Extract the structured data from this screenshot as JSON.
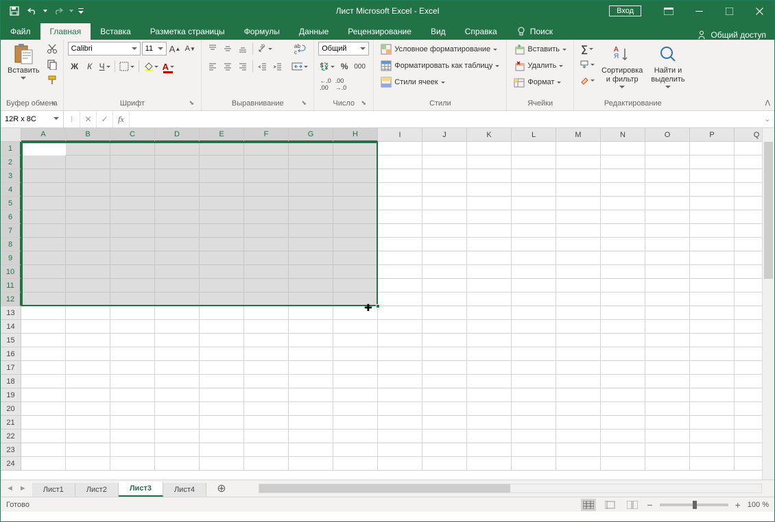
{
  "title": "Лист Microsoft Excel  -  Excel",
  "qat": {
    "save": "💾",
    "undo": "↶",
    "redo": "↷"
  },
  "login_label": "Вход",
  "tabs": {
    "file": "Файл",
    "items": [
      "Главная",
      "Вставка",
      "Разметка страницы",
      "Формулы",
      "Данные",
      "Рецензирование",
      "Вид",
      "Справка"
    ],
    "active": "Главная",
    "tell_me": "Поиск",
    "share": "Общий доступ"
  },
  "ribbon": {
    "clipboard": {
      "label": "Буфер обмена",
      "paste": "Вставить"
    },
    "font": {
      "label": "Шрифт",
      "name": "Calibri",
      "size": "11",
      "bold": "Ж",
      "italic": "К",
      "underline": "Ч"
    },
    "alignment": {
      "label": "Выравнивание"
    },
    "number": {
      "label": "Число",
      "format": "Общий"
    },
    "styles": {
      "label": "Стили",
      "cond_fmt": "Условное форматирование",
      "as_table": "Форматировать как таблицу",
      "cell_styles": "Стили ячеек"
    },
    "cells": {
      "label": "Ячейки",
      "insert": "Вставить",
      "delete": "Удалить",
      "format": "Формат"
    },
    "editing": {
      "label": "Редактирование",
      "sort": "Сортировка\nи фильтр",
      "find": "Найти и\nвыделить"
    }
  },
  "name_box": "12R x 8C",
  "columns": [
    "A",
    "B",
    "C",
    "D",
    "E",
    "F",
    "G",
    "H",
    "I",
    "J",
    "K",
    "L",
    "M",
    "N",
    "O",
    "P",
    "Q"
  ],
  "rows": [
    1,
    2,
    3,
    4,
    5,
    6,
    7,
    8,
    9,
    10,
    11,
    12,
    13,
    14,
    15,
    16,
    17,
    18,
    19,
    20,
    21,
    22,
    23,
    24
  ],
  "selection": {
    "cols": 8,
    "rows": 12
  },
  "sheets": [
    "Лист1",
    "Лист2",
    "Лист3",
    "Лист4"
  ],
  "active_sheet": "Лист3",
  "status": "Готово",
  "zoom": "100 %"
}
